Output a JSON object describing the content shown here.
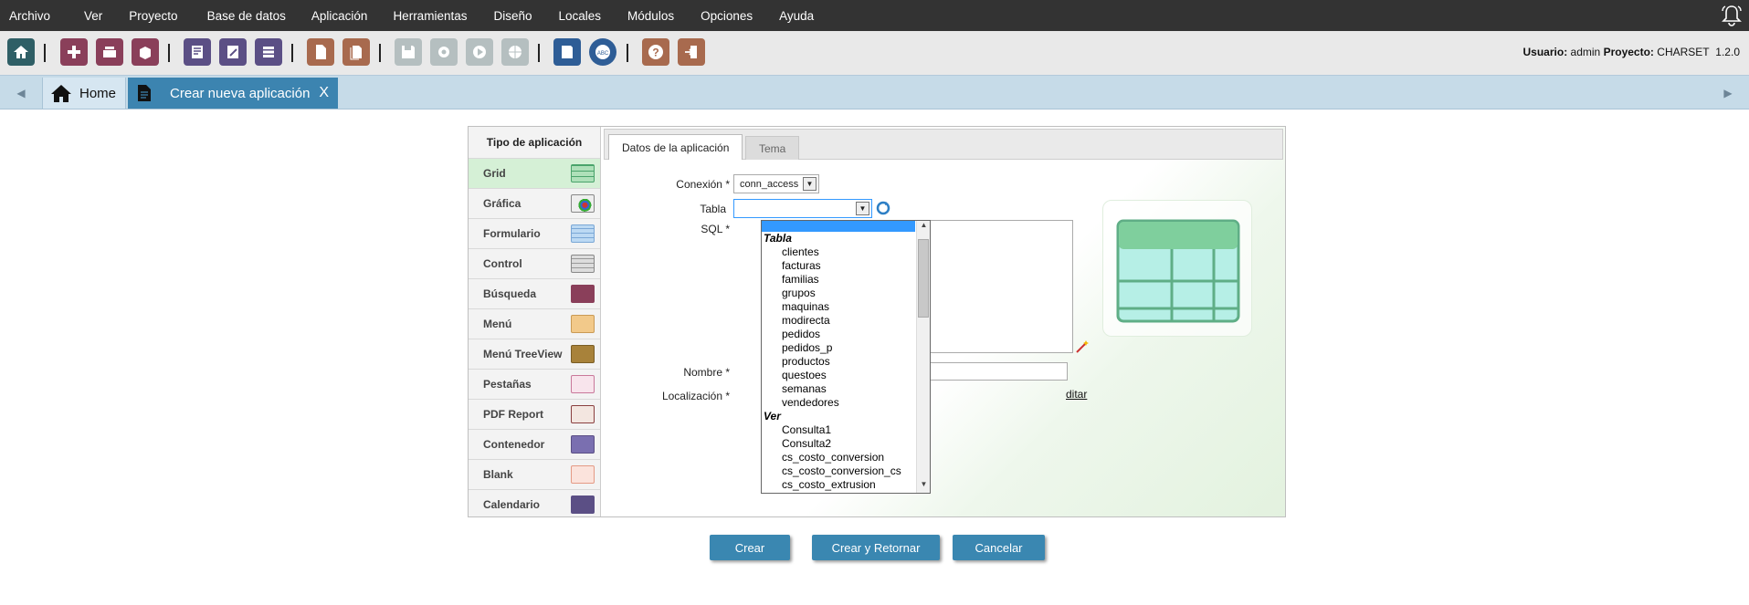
{
  "menu": [
    "Archivo",
    "Ver",
    "Proyecto",
    "Base de datos",
    "Aplicación",
    "Herramientas",
    "Diseño",
    "Locales",
    "Módulos",
    "Opciones",
    "Ayuda"
  ],
  "userinfo": {
    "user_label": "Usuario:",
    "user": "admin",
    "project_label": "Proyecto:",
    "project": "CHARSET",
    "version": "1.2.0"
  },
  "tabs": {
    "home": "Home",
    "current": "Crear nueva aplicación",
    "close": "X"
  },
  "left": {
    "title": "Tipo de aplicación",
    "items": [
      "Grid",
      "Gráfica",
      "Formulario",
      "Control",
      "Búsqueda",
      "Menú",
      "Menú TreeView",
      "Pestañas",
      "PDF Report",
      "Contenedor",
      "Blank",
      "Calendario"
    ]
  },
  "form": {
    "tab_datos": "Datos de la aplicación",
    "tab_tema": "Tema",
    "conexion_label": "Conexión *",
    "conexion_value": "conn_access",
    "tabla_label": "Tabla",
    "sql_label": "SQL *",
    "nombre_label": "Nombre *",
    "localizacion_label": "Localización *",
    "editar_link": "ditar"
  },
  "dropdown": {
    "group1": "Tabla",
    "group1_items": [
      "clientes",
      "facturas",
      "familias",
      "grupos",
      "maquinas",
      "modirecta",
      "pedidos",
      "pedidos_p",
      "productos",
      "questoes",
      "semanas",
      "vendedores"
    ],
    "group2": "Ver",
    "group2_items": [
      "Consulta1",
      "Consulta2",
      "cs_costo_conversion",
      "cs_costo_conversion_cs",
      "cs_costo_extrusion"
    ]
  },
  "buttons": {
    "crear": "Crear",
    "crear_retornar": "Crear y Retornar",
    "cancelar": "Cancelar"
  },
  "colors": {
    "accent": "#3a87b1",
    "selected_item": "#d5f0d6",
    "menubar": "#333333"
  }
}
